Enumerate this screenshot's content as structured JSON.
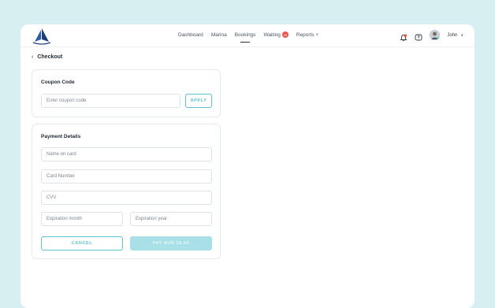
{
  "nav": {
    "items": [
      {
        "label": "Dashboard"
      },
      {
        "label": "Marina"
      },
      {
        "label": "Bookings"
      },
      {
        "label": "Waiting",
        "badge": "25"
      },
      {
        "label": "Reports"
      }
    ]
  },
  "user": {
    "name": "John"
  },
  "breadcrumb": {
    "label": "Checkout"
  },
  "coupon": {
    "title": "Coupon Code",
    "placeholder": "Enter coupon code",
    "apply_label": "APPLY"
  },
  "payment": {
    "title": "Payment Details",
    "name_placeholder": "Name on card",
    "card_placeholder": "Card Number",
    "cvv_placeholder": "CVV",
    "month_placeholder": "Expiration month",
    "year_placeholder": "Expiration year",
    "cancel_label": "CANCEL",
    "pay_label": "PAY AUD 25.00"
  },
  "colors": {
    "accent": "#5ec3d3",
    "accent_light": "#a9e0e8",
    "badge": "#e8524a",
    "brand": "#1e3f7a"
  },
  "icons": {
    "logo": "sailboat-logo",
    "notifications": "bell-icon",
    "help": "help-icon",
    "back": "chevron-left-icon"
  }
}
